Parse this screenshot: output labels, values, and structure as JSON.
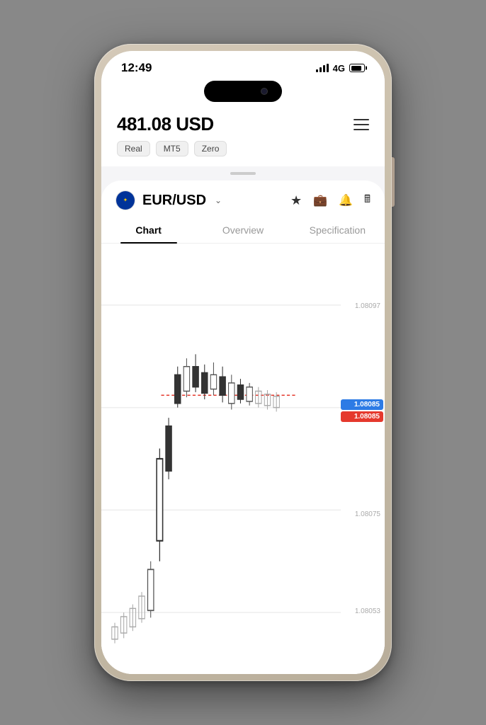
{
  "statusBar": {
    "time": "12:49",
    "signal": "4G"
  },
  "header": {
    "balance": "481.08 USD",
    "menuLabel": "menu",
    "tags": [
      "Real",
      "MT5",
      "Zero"
    ]
  },
  "pair": {
    "symbol": "EUR/USD",
    "flag": "EU",
    "chevron": "∨"
  },
  "actions": {
    "star": "★",
    "briefcase": "🧳",
    "bell": "🔔",
    "calculator": "🖩"
  },
  "tabs": [
    {
      "label": "Chart",
      "active": true
    },
    {
      "label": "Overview",
      "active": false
    },
    {
      "label": "Specification",
      "active": false
    }
  ],
  "chart": {
    "prices": {
      "top": "1.08097",
      "mid_high": "1.08085",
      "mid_low": "1.08085",
      "mid": "1.08075",
      "low": "1.08053"
    },
    "current_bid": "1.08085",
    "current_ask": "1.08085"
  }
}
